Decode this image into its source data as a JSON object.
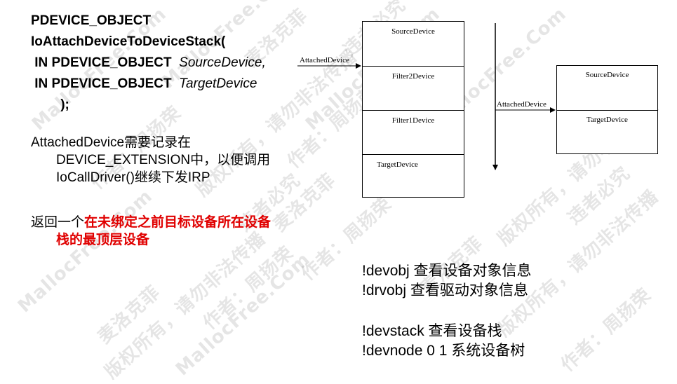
{
  "code": {
    "line1": "PDEVICE_OBJECT",
    "line2": "IoAttachDeviceToDeviceStack(",
    "line3_kw": " IN PDEVICE_OBJECT  ",
    "line3_param": "SourceDevice,",
    "line4_kw": " IN PDEVICE_OBJECT  ",
    "line4_param": "TargetDevice",
    "line5": "        );"
  },
  "para1": {
    "line1": "AttachedDevice需要记录在",
    "line2": "DEVICE_EXTENSION中，以便调用",
    "line3": "IoCallDriver()继续下发IRP"
  },
  "para2": {
    "prefix": "返回一个",
    "highlight1": "在未绑定之前目标设备所在设备",
    "highlight2": "栈的最顶层设备"
  },
  "diagram": {
    "left_stack": [
      "SourceDevice",
      "Filter2Device",
      "Filter1Device",
      "TargetDevice"
    ],
    "right_stack": [
      "SourceDevice",
      "TargetDevice"
    ],
    "arrow_label_left": "AttachedDevice",
    "arrow_label_right": "AttachedDevice"
  },
  "commands": [
    "!devobj 查看设备对象信息",
    "!drvobj 查看驱动对象信息",
    "!devstack 查看设备栈",
    "!devnode 0 1 系统设备树"
  ],
  "watermark": {
    "site": "MallocFree.Com",
    "author": "作者：周扬荣",
    "brand": "麦洛克菲",
    "rights": "版权所有，请勿非法传播",
    "warning": "违者必究"
  }
}
